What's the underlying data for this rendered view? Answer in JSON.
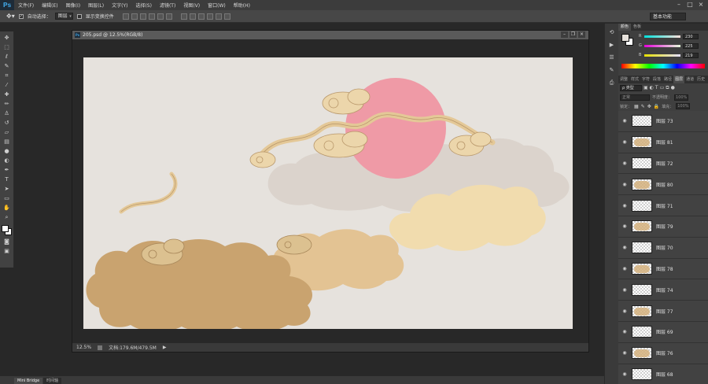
{
  "app": {
    "logo": "Ps"
  },
  "menu": [
    "文件(F)",
    "编辑(E)",
    "图像(I)",
    "图层(L)",
    "文字(Y)",
    "选择(S)",
    "滤镜(T)",
    "视图(V)",
    "窗口(W)",
    "帮助(H)"
  ],
  "options": {
    "auto_select_label": "自动选择：",
    "auto_select_target": "图层",
    "show_transform_label": "显示变换控件",
    "workspace": "基本功能"
  },
  "document": {
    "title": "205.psd @ 12.5%(RGB/8)",
    "zoom": "12.5%",
    "doc_info": "文档:179.6M/479.5M"
  },
  "bottom_tabs": [
    "Mini Bridge",
    "时间轴"
  ],
  "color_panel": {
    "tabs": [
      "颜色",
      "色板"
    ],
    "fg_color": "#e6e1db",
    "channels": [
      {
        "label": "R",
        "value": "230"
      },
      {
        "label": "G",
        "value": "225"
      },
      {
        "label": "B",
        "value": "219"
      }
    ]
  },
  "layers_panel": {
    "tabs": [
      "调整",
      "样式",
      "字符",
      "段落",
      "路径",
      "图层",
      "通道",
      "历史"
    ],
    "filter_kind": "ρ 类型",
    "blend_mode": "正常",
    "opacity_label": "不透明度：",
    "opacity_value": "100%",
    "lock_label": "锁定：",
    "fill_label": "填充：",
    "fill_value": "100%",
    "layers": [
      {
        "name": "图层 73",
        "thumb": "empty"
      },
      {
        "name": "图层 81",
        "thumb": "content"
      },
      {
        "name": "图层 72",
        "thumb": "empty"
      },
      {
        "name": "图层 80",
        "thumb": "content"
      },
      {
        "name": "图层 71",
        "thumb": "empty"
      },
      {
        "name": "图层 79",
        "thumb": "content"
      },
      {
        "name": "图层 70",
        "thumb": "empty"
      },
      {
        "name": "图层 78",
        "thumb": "content"
      },
      {
        "name": "图层 74",
        "thumb": "empty"
      },
      {
        "name": "图层 77",
        "thumb": "content"
      },
      {
        "name": "图层 69",
        "thumb": "empty"
      },
      {
        "name": "图层 76",
        "thumb": "content"
      },
      {
        "name": "图层 68",
        "thumb": "empty"
      }
    ]
  },
  "colors": {
    "canvas_bg": "#e6e2dd",
    "sun": "#ef9aa6",
    "cloud_gold": "#c9a36f",
    "cloud_light": "#f1dcae",
    "cloud_grey": "#d9d1ca"
  }
}
